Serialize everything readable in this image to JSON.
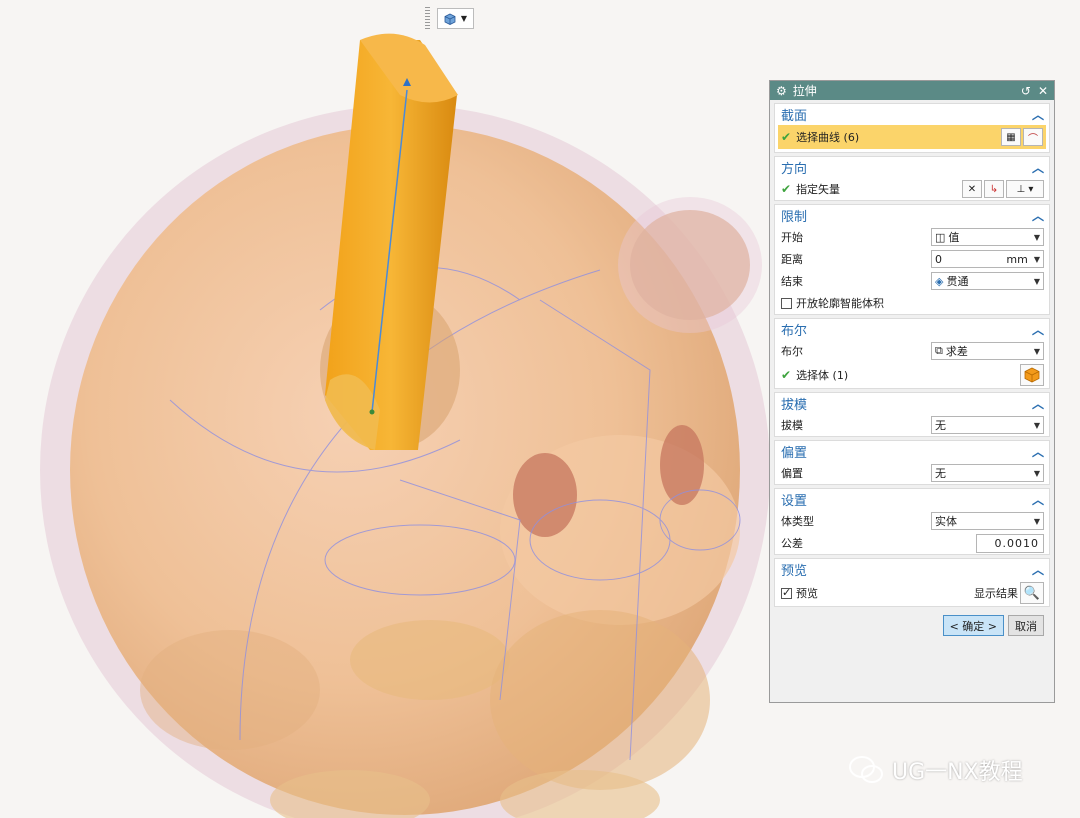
{
  "dialog": {
    "title": "拉伸",
    "sections": {
      "section_curve": {
        "title": "截面",
        "select_curve": "选择曲线 (6)"
      },
      "direction": {
        "title": "方向",
        "specify_vector": "指定矢量"
      },
      "limits": {
        "title": "限制",
        "start_label": "开始",
        "start_value": "值",
        "distance_label": "距离",
        "distance_value": "0",
        "distance_unit": "mm",
        "end_label": "结束",
        "end_value": "贯通",
        "open_profile_label": "开放轮廓智能体积"
      },
      "boolean": {
        "title": "布尔",
        "boolean_label": "布尔",
        "boolean_value": "求差",
        "select_body": "选择体 (1)"
      },
      "draft": {
        "title": "拔模",
        "draft_label": "拔模",
        "draft_value": "无"
      },
      "offset": {
        "title": "偏置",
        "offset_label": "偏置",
        "offset_value": "无"
      },
      "settings": {
        "title": "设置",
        "body_type_label": "体类型",
        "body_type_value": "实体",
        "tolerance_label": "公差",
        "tolerance_value": "0.0010"
      },
      "preview": {
        "title": "预览",
        "preview_label": "预览",
        "show_result_label": "显示结果"
      }
    },
    "buttons": {
      "ok": "< 确定 >",
      "cancel": "取消"
    }
  },
  "watermark": {
    "text": "UG一NX教程"
  },
  "colors": {
    "titlebar": "#5b8a86",
    "section_title": "#2a6eb0",
    "selected_row": "#fbd46a",
    "extrude_body": "#f0a21a"
  }
}
